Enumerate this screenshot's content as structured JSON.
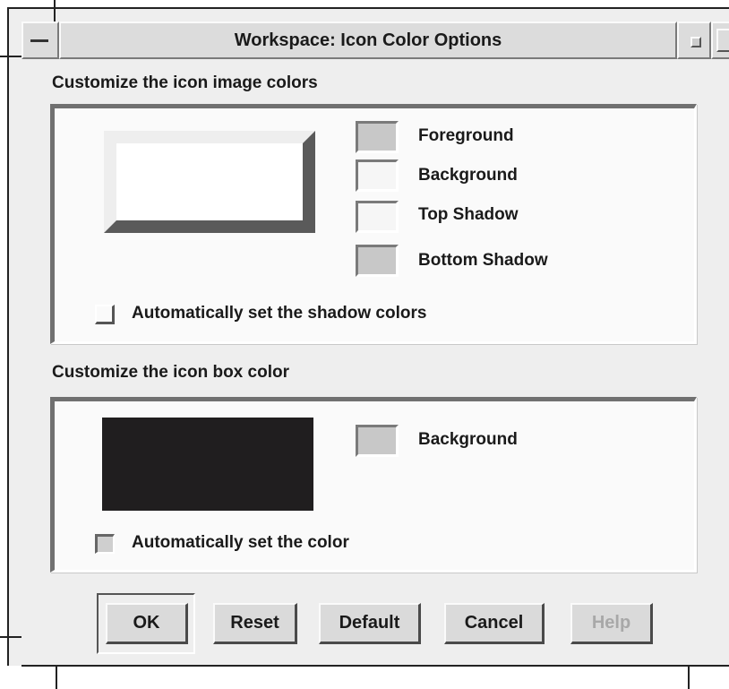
{
  "window": {
    "title": "Workspace: Icon Color Options"
  },
  "image_colors": {
    "heading": "Customize the icon image colors",
    "swatches": [
      {
        "label": "Foreground",
        "color": "#c8c8c8"
      },
      {
        "label": "Background",
        "color": "#f6f6f6"
      },
      {
        "label": "Top Shadow",
        "color": "#f6f6f6"
      },
      {
        "label": "Bottom Shadow",
        "color": "#c8c8c8"
      }
    ],
    "auto_shadow_label": "Automatically set the shadow colors",
    "auto_shadow_checked": false,
    "preview_colors": {
      "face": "#ffffff",
      "top_shadow": "#eeeeee",
      "bottom_shadow": "#5a5a5a"
    }
  },
  "box_color": {
    "heading": "Customize the icon box color",
    "swatch": {
      "label": "Background",
      "color": "#c8c8c8"
    },
    "preview_color": "#201e1f",
    "auto_color_label": "Automatically set the color",
    "auto_color_checked": true
  },
  "buttons": {
    "ok": "OK",
    "reset": "Reset",
    "default": "Default",
    "cancel": "Cancel",
    "help": "Help"
  }
}
